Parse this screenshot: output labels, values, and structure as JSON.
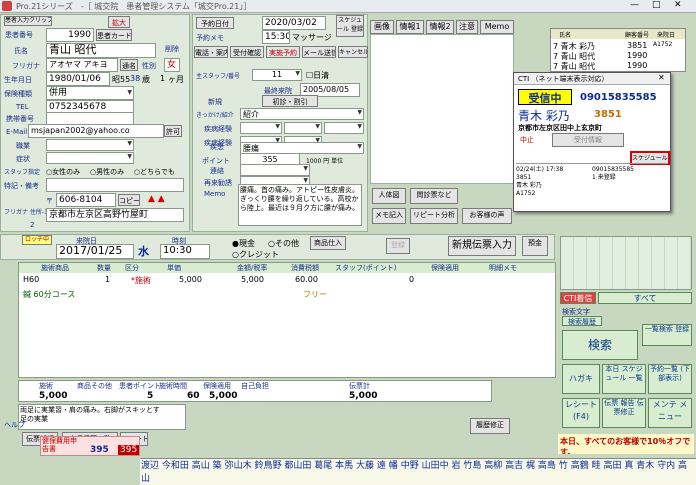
{
  "window": {
    "title": "Pro.21シリーズ　-［ 城交院　患者管理システム「城交Pro.21」］"
  },
  "patient": {
    "header_btn": "患者入力クリップ",
    "expand_btn": "拡大",
    "delete_label": "削除",
    "no_label": "患者番号",
    "no": "1990",
    "card_label": "患者カード",
    "name_label": "氏名",
    "name": "青山 昭代",
    "kana_label": "フリガナ",
    "kana": "アオヤマ アキヨ",
    "reception": "通名",
    "sex_label": "性別",
    "sex": "女",
    "birth_label": "生年月日",
    "birth": "1980/01/06",
    "era": "昭55",
    "age": "38",
    "age_unit": "歳",
    "month": "1",
    "month_unit": "ヶ月",
    "insurance_label": "保険種類",
    "insurance": "併用",
    "tel_label": "TEL",
    "tel": "0752345678",
    "mobile_label": "携帯番号",
    "mail_label": "E-Mail",
    "mail": "msjapan2002@yahoo.co",
    "mail_btn": "許可",
    "work_label": "職業",
    "symptoms_label": "症状",
    "staff_label": "スタッフ指定",
    "radio1": "女性のみ",
    "radio2": "男性のみ",
    "radio3": "どちらでも",
    "memo_label": "特記・備考",
    "zip_label": "〒",
    "zip": "606-8104",
    "zip_btn": "コピー",
    "addr_label": "フリガナ 住所-1",
    "addr2_label": "2",
    "address": "京都市左京区高野竹屋町"
  },
  "booking": {
    "date_label": "予約日付",
    "date": "2020/03/02",
    "time": "15:30",
    "service": "マッサージ",
    "sched_btn": "スケジュール 登録",
    "next_label": "予約メモ",
    "status_tabs": [
      "電話・案内",
      "受付確認",
      "実施予約",
      "メール送信",
      "キャンセル処理"
    ],
    "staff_label": "主スタッフ/番号",
    "staff_no": "11",
    "sunday": "日清",
    "first_label": "初回日",
    "final_label": "最終来院",
    "final_date": "2005/08/05",
    "new_label": "新規",
    "first_visit": "初診・割引",
    "trigger_label": "きっかけ/紹介",
    "trigger": "紹介",
    "related_label": "疾病経験",
    "exp_label": "疾病経験",
    "disease_label": "疾患",
    "disease": "腰痛",
    "point_label": "ポイント",
    "point": "355",
    "point_unit": "1000 円 単位",
    "contact_label": "連絡",
    "revisit_label": "再来勧誘",
    "memo_label": "Memo",
    "memo": "腰痛。首の痛み。アトピー性皮膚炎。\nぎっくり腰を繰り返している。高校から陸上。最近は９月ク方に腰が痛み。"
  },
  "tabs": [
    "画像",
    "情報1",
    "情報2",
    "注意",
    "Memo"
  ],
  "side_btns": [
    "人体図",
    "問診票など",
    "メモ記入",
    "リピート分析",
    "お客様の声"
  ],
  "patient_list": {
    "headers": [
      "氏名",
      "顧客番号",
      "来院日"
    ],
    "rows": [
      [
        "7 青木 彩乃",
        "3851",
        "A1752"
      ],
      [
        "7 青山 昭代",
        "1990",
        ""
      ],
      [
        "7 青山 昭代",
        "1990",
        ""
      ]
    ]
  },
  "cti": {
    "title": "CTI （ネット端末表示対応）",
    "status": "受信中",
    "phone": "09015835585",
    "name": "青木 彩乃",
    "no": "3851",
    "address": "京都市左京区田中上玄京町",
    "stop_btn": "中止",
    "info_btn": "受付情報",
    "sched_btn": "スケジュール予約",
    "log": [
      [
        "02/24(土) 17:38",
        "3851",
        "青木 彩乃",
        "A1752"
      ],
      [
        "02/24(土) 17:39",
        "09015835585",
        "1 来登録",
        ""
      ]
    ]
  },
  "visit": {
    "clip_label": "ロッチ中",
    "date_label": "来院日",
    "date": "2017/01/25",
    "weekday": "水",
    "time_label": "時刻",
    "time": "10:30",
    "pay1": "現金",
    "pay2": "その他",
    "pay3": "クレジット",
    "prod_btn": "商品仕入",
    "new_slip_btn": "新規伝票入力",
    "reg_btn": "登録",
    "continue_label": "連続",
    "deposit_btn": "預金"
  },
  "table": {
    "headers": [
      "施術商品",
      "数量",
      "区分",
      "単価",
      "金額/税率",
      "消費税額",
      "スタッフ(ポイント)",
      "保険適用",
      "明細メモ"
    ],
    "rows": [
      [
        "H60",
        "1",
        "*施術",
        "5,000",
        "5,000",
        "60.00",
        "0",
        "",
        ""
      ],
      [
        "鍼 60分コース",
        "",
        "",
        "",
        "",
        "",
        "フリー",
        "",
        ""
      ]
    ]
  },
  "totals": {
    "labels": [
      "施術",
      "商品その他",
      "患者ポイント",
      "施術時間",
      "保険適用",
      "自己負担",
      "伝票計"
    ],
    "values": [
      "5,000",
      "",
      "5",
      "60",
      "5,000",
      "",
      "5,000"
    ],
    "misc": [
      "ポイント累計",
      "レジ",
      "おつり"
    ]
  },
  "treatment": {
    "memo": "両足に実業習・肩の痛み。右脚がスキッとす\n足の実業",
    "tags": [
      "症状",
      "施術",
      "電療",
      "あんま",
      "マイ",
      "運動"
    ]
  },
  "bottom": {
    "menu_label": "伝票新規",
    "menu2": "未収伝票一覧",
    "receipt": "レシート 発行",
    "money_label": "集金",
    "money": "1",
    "history_label": "履歴修正",
    "check": "全",
    "fee_label": "健保費用申告書",
    "fee": "395",
    "fee2": "395",
    "notice": "本日、すべてのお客様で10％オフです。",
    "names": [
      "渡辺",
      "今和田",
      "高山",
      "築",
      "弥山木",
      "鈴鳥野",
      "都山田",
      "葛尾",
      "本馬",
      "大藤",
      "遠",
      "幡",
      "中野",
      "山田中",
      "岩",
      "竹島",
      "高柳",
      "高吉",
      "梶",
      "高島",
      "竹",
      "高鶴",
      "畦",
      "高田",
      "真",
      "青木",
      "守内",
      "高山"
    ]
  },
  "right_panel": {
    "title": "CTI着信",
    "all": "すべて",
    "search_label": "検索文字",
    "search_btn": "検索履歴",
    "search": "検索",
    "btn1": "一覧検索 登録",
    "btns": [
      "ハガキ",
      "本日 スケジュール 一覧",
      "予約一覧 (下部表示)",
      "レシート (F4)",
      "伝票 報告 伝票修正",
      "メンテ メニュー",
      "預収書",
      "お仕事"
    ],
    "help": "ヘルプ"
  },
  "colors": {
    "bg": "#c8d8c0",
    "accent": "#0a2a9a",
    "alert": "#c00000",
    "notice_bg": "#fff8c8"
  }
}
